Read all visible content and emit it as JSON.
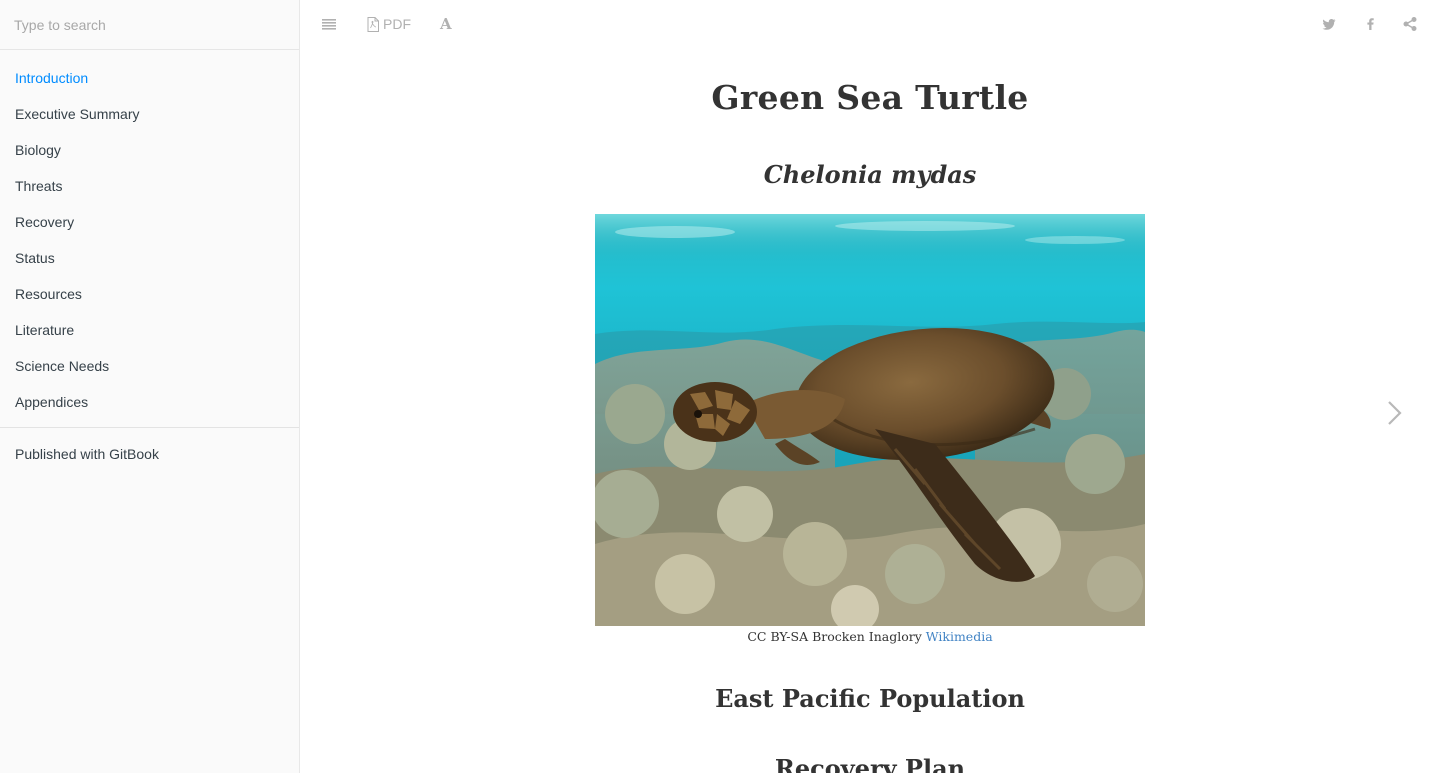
{
  "search": {
    "placeholder": "Type to search"
  },
  "sidebar": {
    "items": [
      {
        "label": "Introduction",
        "active": true
      },
      {
        "label": "Executive Summary"
      },
      {
        "label": "Biology"
      },
      {
        "label": "Threats"
      },
      {
        "label": "Recovery"
      },
      {
        "label": "Status"
      },
      {
        "label": "Resources"
      },
      {
        "label": "Literature"
      },
      {
        "label": "Science Needs"
      },
      {
        "label": "Appendices"
      }
    ],
    "published": "Published with GitBook"
  },
  "toolbar": {
    "menu_icon": "hamburger-icon",
    "pdf_label": "PDF",
    "font_label": "A",
    "twitter_icon": "twitter-icon",
    "facebook_icon": "facebook-icon",
    "share_icon": "share-icon"
  },
  "page": {
    "title": "Green Sea Turtle",
    "subtitle": "Chelonia mydas",
    "caption_text": "CC BY-SA Brocken Inaglory ",
    "caption_link": "Wikimedia",
    "section_heading": "East Pacific Population",
    "section_heading_2": "Recovery Plan"
  },
  "colors": {
    "active_link": "#008cff",
    "caption_link": "#4183c4",
    "sidebar_bg": "#fafafa"
  }
}
